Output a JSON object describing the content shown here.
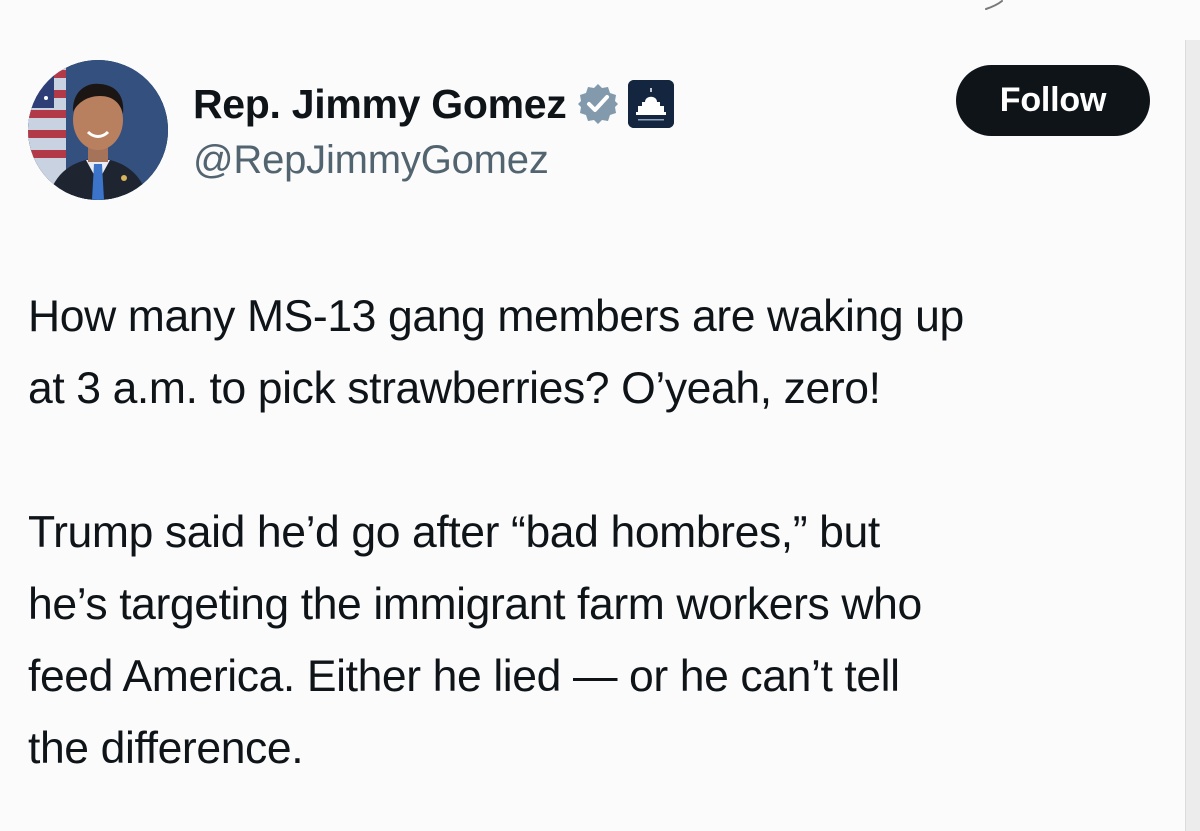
{
  "author": {
    "display_name": "Rep. Jimmy Gomez",
    "handle": "@RepJimmyGomez",
    "verified_icon": "verified-badge-icon",
    "affiliation_icon": "house-democrats-capitol-icon"
  },
  "follow_button": {
    "label": "Follow"
  },
  "tweet": {
    "paragraphs": [
      "How many MS-13 gang members are waking up\nat 3 a.m. to pick strawberries? O’yeah, zero!",
      "Trump said he’d go after “bad hombres,” but\nhe’s targeting the immigrant farm workers who\nfeed America. Either he lied — or he can’t tell\nthe difference."
    ]
  },
  "colors": {
    "text": "#0f1419",
    "secondary_text": "#536471",
    "follow_button_bg": "#0f1419",
    "follow_button_text": "#ffffff",
    "verified_badge": "#829aab",
    "affiliation_badge_bg": "#13253f"
  }
}
